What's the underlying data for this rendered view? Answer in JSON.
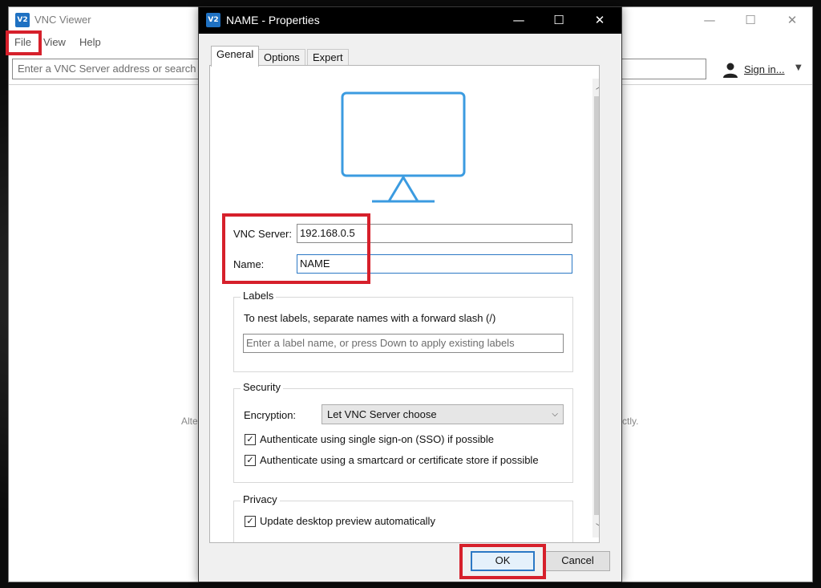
{
  "main_window": {
    "app_name": "VNC Viewer",
    "logo_text": "V2",
    "menu": [
      "File",
      "View",
      "Help"
    ],
    "search_placeholder": "Enter a VNC Server address or search",
    "sign_in": "Sign in...",
    "bg_hint_left": "Alte",
    "bg_hint_right": "ctly.",
    "controls": {
      "minimize": "—",
      "maximize": "☐",
      "close": "✕"
    }
  },
  "dialog": {
    "title": "NAME - Properties",
    "logo_text": "V2",
    "controls": {
      "minimize": "—",
      "maximize": "☐",
      "close": "✕"
    },
    "tabs": [
      "General",
      "Options",
      "Expert"
    ],
    "active_tab": "General",
    "vnc_server_label": "VNC Server:",
    "vnc_server_value": "192.168.0.5",
    "name_label": "Name:",
    "name_value": "NAME",
    "labels_group": {
      "title": "Labels",
      "hint": "To nest labels, separate names with a forward slash (/)",
      "placeholder": "Enter a label name, or press Down to apply existing labels"
    },
    "security_group": {
      "title": "Security",
      "encryption_label": "Encryption:",
      "encryption_value": "Let VNC Server choose",
      "checks": [
        {
          "label": "Authenticate using single sign-on (SSO) if possible",
          "checked": true
        },
        {
          "label": "Authenticate using a smartcard or certificate store if possible",
          "checked": true
        }
      ]
    },
    "privacy_group": {
      "title": "Privacy",
      "checks": [
        {
          "label": "Update desktop preview automatically",
          "checked": true
        }
      ]
    },
    "ok_label": "OK",
    "cancel_label": "Cancel"
  },
  "colors": {
    "highlight_red": "#d6202b",
    "accent_blue": "#2b78c5",
    "monitor_blue": "#3b9be0",
    "logo_blue": "#1f71c2"
  },
  "icons": {
    "app_logo": "vnc-logo-icon",
    "user": "user-icon",
    "monitor": "monitor-icon",
    "check": "checkmark-icon"
  }
}
